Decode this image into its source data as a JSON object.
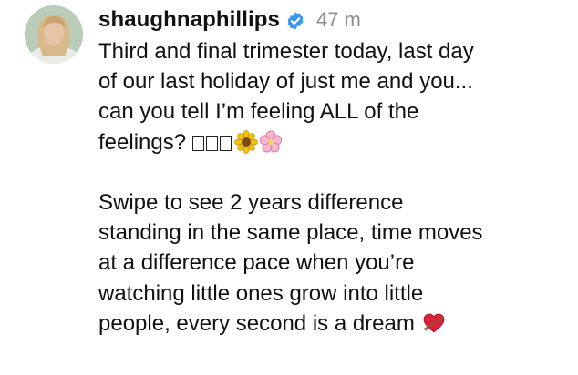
{
  "post": {
    "username": "shaughnaphillips",
    "timestamp": "47 m",
    "caption_lines_1": [
      "Third and final trimester today, last day",
      "of our last holiday of just me and you...",
      "can you tell I’m feeling ALL of the"
    ],
    "caption_line_4_text": "feelings?",
    "caption_lines_2": [
      "Swipe to see 2 years difference",
      "standing in the same place, time moves",
      "at a difference pace when you’re",
      "watching little ones grow into little"
    ],
    "caption_last_line_text": "people, every second is a dream",
    "emojis": [
      "missing-glyph",
      "missing-glyph",
      "missing-glyph",
      "sunflower-icon",
      "cherry-blossom-icon",
      "heart-arrow-icon"
    ],
    "colors": {
      "verified": "#3897f0",
      "timestamp": "#8e8e8e",
      "text": "#111111"
    }
  }
}
